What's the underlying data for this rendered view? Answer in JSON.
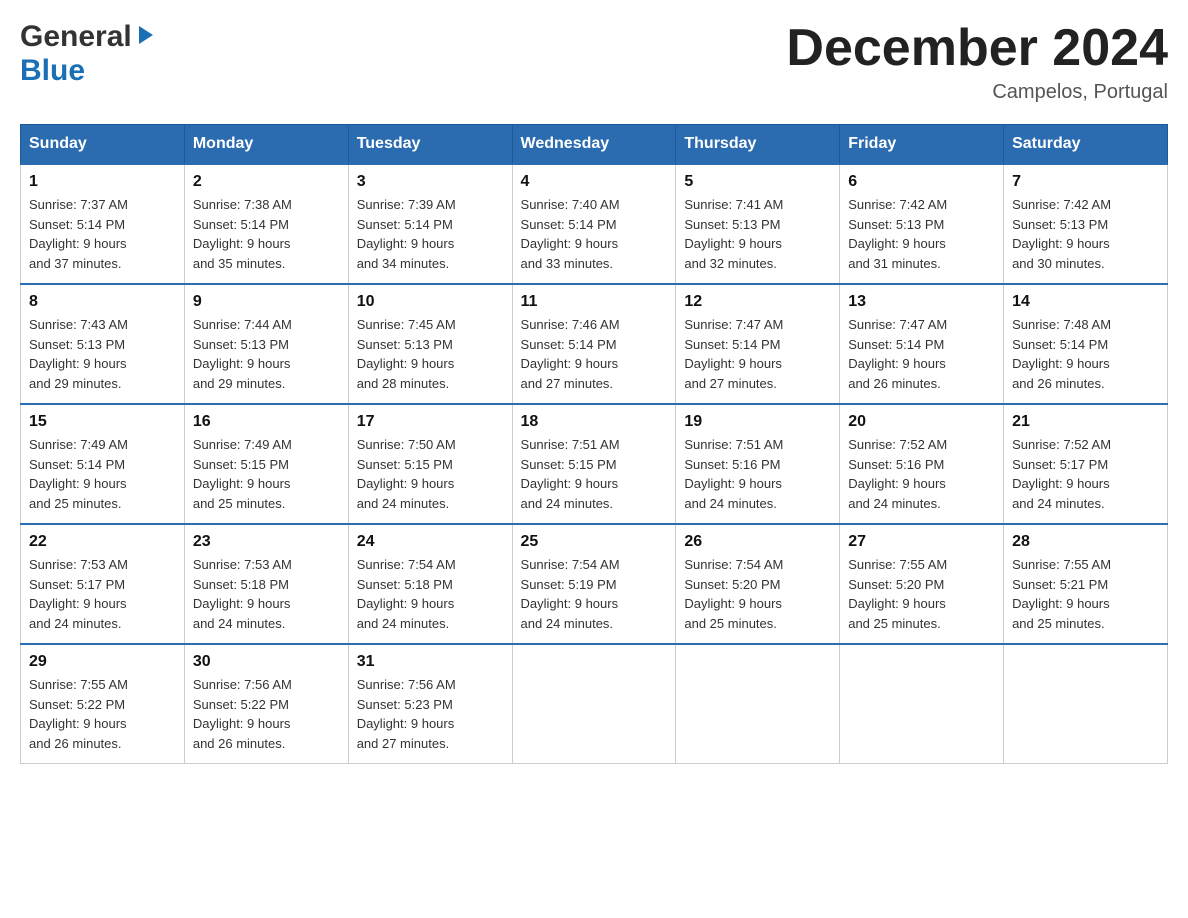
{
  "logo": {
    "general": "General",
    "blue": "Blue",
    "arrow": "▶"
  },
  "title": "December 2024",
  "location": "Campelos, Portugal",
  "days_of_week": [
    "Sunday",
    "Monday",
    "Tuesday",
    "Wednesday",
    "Thursday",
    "Friday",
    "Saturday"
  ],
  "weeks": [
    [
      {
        "day": "1",
        "sunrise": "7:37 AM",
        "sunset": "5:14 PM",
        "daylight": "9 hours and 37 minutes."
      },
      {
        "day": "2",
        "sunrise": "7:38 AM",
        "sunset": "5:14 PM",
        "daylight": "9 hours and 35 minutes."
      },
      {
        "day": "3",
        "sunrise": "7:39 AM",
        "sunset": "5:14 PM",
        "daylight": "9 hours and 34 minutes."
      },
      {
        "day": "4",
        "sunrise": "7:40 AM",
        "sunset": "5:14 PM",
        "daylight": "9 hours and 33 minutes."
      },
      {
        "day": "5",
        "sunrise": "7:41 AM",
        "sunset": "5:13 PM",
        "daylight": "9 hours and 32 minutes."
      },
      {
        "day": "6",
        "sunrise": "7:42 AM",
        "sunset": "5:13 PM",
        "daylight": "9 hours and 31 minutes."
      },
      {
        "day": "7",
        "sunrise": "7:42 AM",
        "sunset": "5:13 PM",
        "daylight": "9 hours and 30 minutes."
      }
    ],
    [
      {
        "day": "8",
        "sunrise": "7:43 AM",
        "sunset": "5:13 PM",
        "daylight": "9 hours and 29 minutes."
      },
      {
        "day": "9",
        "sunrise": "7:44 AM",
        "sunset": "5:13 PM",
        "daylight": "9 hours and 29 minutes."
      },
      {
        "day": "10",
        "sunrise": "7:45 AM",
        "sunset": "5:13 PM",
        "daylight": "9 hours and 28 minutes."
      },
      {
        "day": "11",
        "sunrise": "7:46 AM",
        "sunset": "5:14 PM",
        "daylight": "9 hours and 27 minutes."
      },
      {
        "day": "12",
        "sunrise": "7:47 AM",
        "sunset": "5:14 PM",
        "daylight": "9 hours and 27 minutes."
      },
      {
        "day": "13",
        "sunrise": "7:47 AM",
        "sunset": "5:14 PM",
        "daylight": "9 hours and 26 minutes."
      },
      {
        "day": "14",
        "sunrise": "7:48 AM",
        "sunset": "5:14 PM",
        "daylight": "9 hours and 26 minutes."
      }
    ],
    [
      {
        "day": "15",
        "sunrise": "7:49 AM",
        "sunset": "5:14 PM",
        "daylight": "9 hours and 25 minutes."
      },
      {
        "day": "16",
        "sunrise": "7:49 AM",
        "sunset": "5:15 PM",
        "daylight": "9 hours and 25 minutes."
      },
      {
        "day": "17",
        "sunrise": "7:50 AM",
        "sunset": "5:15 PM",
        "daylight": "9 hours and 24 minutes."
      },
      {
        "day": "18",
        "sunrise": "7:51 AM",
        "sunset": "5:15 PM",
        "daylight": "9 hours and 24 minutes."
      },
      {
        "day": "19",
        "sunrise": "7:51 AM",
        "sunset": "5:16 PM",
        "daylight": "9 hours and 24 minutes."
      },
      {
        "day": "20",
        "sunrise": "7:52 AM",
        "sunset": "5:16 PM",
        "daylight": "9 hours and 24 minutes."
      },
      {
        "day": "21",
        "sunrise": "7:52 AM",
        "sunset": "5:17 PM",
        "daylight": "9 hours and 24 minutes."
      }
    ],
    [
      {
        "day": "22",
        "sunrise": "7:53 AM",
        "sunset": "5:17 PM",
        "daylight": "9 hours and 24 minutes."
      },
      {
        "day": "23",
        "sunrise": "7:53 AM",
        "sunset": "5:18 PM",
        "daylight": "9 hours and 24 minutes."
      },
      {
        "day": "24",
        "sunrise": "7:54 AM",
        "sunset": "5:18 PM",
        "daylight": "9 hours and 24 minutes."
      },
      {
        "day": "25",
        "sunrise": "7:54 AM",
        "sunset": "5:19 PM",
        "daylight": "9 hours and 24 minutes."
      },
      {
        "day": "26",
        "sunrise": "7:54 AM",
        "sunset": "5:20 PM",
        "daylight": "9 hours and 25 minutes."
      },
      {
        "day": "27",
        "sunrise": "7:55 AM",
        "sunset": "5:20 PM",
        "daylight": "9 hours and 25 minutes."
      },
      {
        "day": "28",
        "sunrise": "7:55 AM",
        "sunset": "5:21 PM",
        "daylight": "9 hours and 25 minutes."
      }
    ],
    [
      {
        "day": "29",
        "sunrise": "7:55 AM",
        "sunset": "5:22 PM",
        "daylight": "9 hours and 26 minutes."
      },
      {
        "day": "30",
        "sunrise": "7:56 AM",
        "sunset": "5:22 PM",
        "daylight": "9 hours and 26 minutes."
      },
      {
        "day": "31",
        "sunrise": "7:56 AM",
        "sunset": "5:23 PM",
        "daylight": "9 hours and 27 minutes."
      },
      null,
      null,
      null,
      null
    ]
  ],
  "labels": {
    "sunrise": "Sunrise: ",
    "sunset": "Sunset: ",
    "daylight": "Daylight: "
  }
}
